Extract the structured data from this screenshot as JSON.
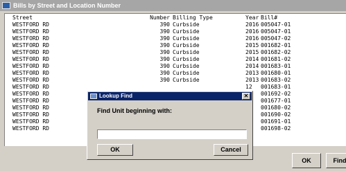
{
  "window": {
    "title": "Bills by Street and Location Number"
  },
  "table": {
    "headers": {
      "street": "Street",
      "number": "Number",
      "billing_type": "Billing Type",
      "year": "Year",
      "bill": "Bill#"
    },
    "rows": [
      {
        "street": "WESTFORD RD",
        "number": "390",
        "billing_type": "Curbside",
        "year": "2016",
        "bill": "005047-01"
      },
      {
        "street": "WESTFORD RD",
        "number": "390",
        "billing_type": "Curbside",
        "year": "2016",
        "bill": "005047-01"
      },
      {
        "street": "WESTFORD RD",
        "number": "390",
        "billing_type": "Curbside",
        "year": "2016",
        "bill": "005047-02"
      },
      {
        "street": "WESTFORD RD",
        "number": "390",
        "billing_type": "Curbside",
        "year": "2015",
        "bill": "001682-01"
      },
      {
        "street": "WESTFORD RD",
        "number": "390",
        "billing_type": "Curbside",
        "year": "2015",
        "bill": "001682-02"
      },
      {
        "street": "WESTFORD RD",
        "number": "390",
        "billing_type": "Curbside",
        "year": "2014",
        "bill": "001681-02"
      },
      {
        "street": "WESTFORD RD",
        "number": "390",
        "billing_type": "Curbside",
        "year": "2014",
        "bill": "001683-01"
      },
      {
        "street": "WESTFORD RD",
        "number": "390",
        "billing_type": "Curbside",
        "year": "2013",
        "bill": "001680-01"
      },
      {
        "street": "WESTFORD RD",
        "number": "390",
        "billing_type": "Curbside",
        "year": "2013",
        "bill": "001683-02"
      },
      {
        "street": "WESTFORD RD",
        "number": "",
        "billing_type": "",
        "year": "12",
        "bill": "001683-01"
      },
      {
        "street": "WESTFORD RD",
        "number": "",
        "billing_type": "",
        "year": "12",
        "bill": "001692-02"
      },
      {
        "street": "WESTFORD RD",
        "number": "",
        "billing_type": "",
        "year": "11",
        "bill": "001677-01"
      },
      {
        "street": "WESTFORD RD",
        "number": "",
        "billing_type": "",
        "year": "10",
        "bill": "001680-02"
      },
      {
        "street": "WESTFORD RD",
        "number": "",
        "billing_type": "",
        "year": "10",
        "bill": "001690-02"
      },
      {
        "street": "WESTFORD RD",
        "number": "",
        "billing_type": "",
        "year": "10",
        "bill": "001691-01"
      },
      {
        "street": "WESTFORD RD",
        "number": "",
        "billing_type": "",
        "year": "09",
        "bill": "001698-02"
      }
    ]
  },
  "buttons": {
    "ok": "OK",
    "find": "Find"
  },
  "dialog": {
    "title": "Lookup Find",
    "close_glyph": "✕",
    "label": "Find Unit beginning with:",
    "input_value": "",
    "ok": "OK",
    "cancel": "Cancel"
  },
  "icons": {
    "app": "window-app-icon",
    "dialog": "dialog-app-icon",
    "close": "close-icon"
  }
}
